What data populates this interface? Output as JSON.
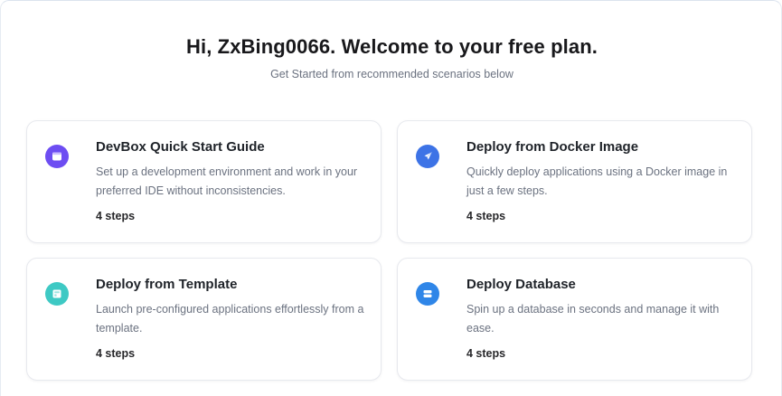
{
  "header": {
    "title": "Hi, ZxBing0066. Welcome to your free plan.",
    "subtitle": "Get Started from recommended scenarios below"
  },
  "cards": [
    {
      "title": "DevBox Quick Start Guide",
      "description": "Set up a development environment and work in your preferred IDE without inconsistencies.",
      "steps": "4 steps",
      "icon": "devbox-icon",
      "color": "#6d4df2"
    },
    {
      "title": "Deploy from Docker Image",
      "description": "Quickly deploy applications using a Docker image in just a few steps.",
      "steps": "4 steps",
      "icon": "rocket-icon",
      "color": "#3d73e6"
    },
    {
      "title": "Deploy from Template",
      "description": "Launch pre-configured applications effortlessly from a template.",
      "steps": "4 steps",
      "icon": "template-icon",
      "color": "#3ec9c4"
    },
    {
      "title": "Deploy Database",
      "description": "Spin up a database in seconds and manage it with ease.",
      "steps": "4 steps",
      "icon": "database-icon",
      "color": "#2f86e8"
    }
  ]
}
